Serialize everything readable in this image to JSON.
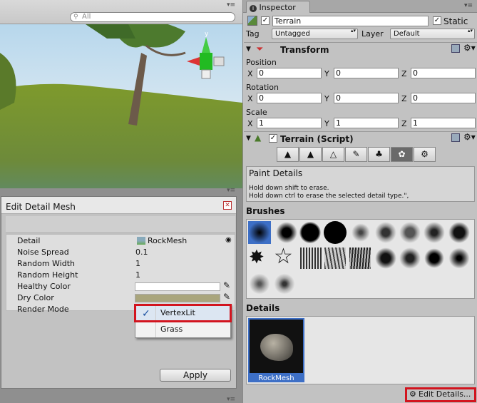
{
  "scene": {
    "search_placeholder": "All",
    "gizmo_axis": "y"
  },
  "dialog": {
    "title": "Edit Detail Mesh",
    "rows": {
      "detail_label": "Detail",
      "detail_value": "RockMesh",
      "noise_label": "Noise Spread",
      "noise_value": "0.1",
      "width_label": "Random Width",
      "width_value": "1",
      "height_label": "Random Height",
      "height_value": "1",
      "healthy_label": "Healthy Color",
      "dry_label": "Dry Color",
      "render_label": "Render Mode"
    },
    "healthy_color": "#ffffff",
    "dry_color": "#a9a57c",
    "render_mode_options": [
      "VertexLit",
      "Grass"
    ],
    "apply_label": "Apply"
  },
  "inspector": {
    "tab_label": "Inspector",
    "object_name": "Terrain",
    "static_label": "Static",
    "tag_label": "Tag",
    "tag_value": "Untagged",
    "layer_label": "Layer",
    "layer_value": "Default",
    "transform": {
      "title": "Transform",
      "position_label": "Position",
      "rotation_label": "Rotation",
      "scale_label": "Scale",
      "x": "X",
      "y": "Y",
      "z": "Z",
      "position": [
        "0",
        "0",
        "0"
      ],
      "rotation": [
        "0",
        "0",
        "0"
      ],
      "scale": [
        "1",
        "1",
        "1"
      ]
    },
    "terrain_script": {
      "title": "Terrain (Script)",
      "help_title": "Paint Details",
      "help_line1": "Hold down shift to erase.",
      "help_line2": "Hold down ctrl to erase the selected detail type.\",",
      "brushes_label": "Brushes",
      "details_label": "Details",
      "detail_item": "RockMesh",
      "edit_details": "Edit Details..."
    }
  },
  "colors": {
    "selection": "#3d6fc6",
    "highlight_box": "#d2141e"
  }
}
